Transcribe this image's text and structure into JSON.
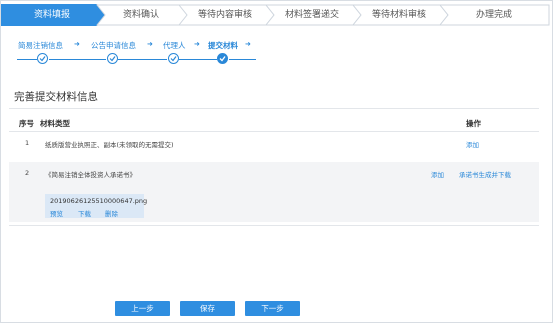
{
  "colors": {
    "accent": "#2a88d8",
    "active_step": "#2f8ee0",
    "row_alt": "#f3f4f6",
    "file_bg": "#dbe8f6"
  },
  "steps": [
    "资料填报",
    "资料确认",
    "等待内容审核",
    "材料签署递交",
    "等待材料审核",
    "办理完成"
  ],
  "active_step_index": 0,
  "sub_steps": [
    "简易注销信息",
    "公告申请信息",
    "代理人",
    "提交材料"
  ],
  "sub_step_current_index": 3,
  "section_title": "完善提交材料信息",
  "table": {
    "headers": {
      "index": "序号",
      "type": "材料类型",
      "action": "操作"
    },
    "rows": [
      {
        "index": "1",
        "type": "纸质版营业执照正、副本(未领取的无需提交)",
        "actions": [
          "添加"
        ]
      },
      {
        "index": "2",
        "type": "《简易注销全体投资人承诺书》",
        "actions": [
          "添加",
          "承诺书生成并下载"
        ]
      }
    ]
  },
  "file": {
    "name": "20190626125510000647.png",
    "actions": [
      "预览",
      "下载",
      "删除"
    ]
  },
  "buttons": {
    "prev": "上一步",
    "save": "保存",
    "next": "下一步"
  }
}
